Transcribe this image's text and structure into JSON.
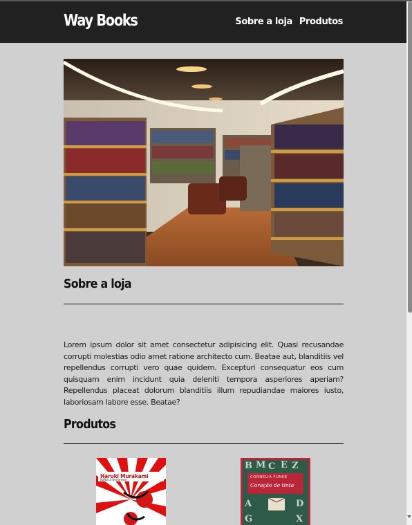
{
  "header": {
    "logo": "Way Books",
    "nav": [
      {
        "label": "Sobre a loja"
      },
      {
        "label": "Produtos"
      }
    ]
  },
  "about": {
    "title": "Sobre a loja",
    "text": "Lorem ipsum dolor sit amet consectetur adipisicing elit. Quasi recusandae corrupti molestias odio amet ratione architecto cum. Beatae aut, blanditiis vel repellendus corrupti vero quae quidem. Excepturi consequatur eos cum quisquam enim incidunt quia deleniti tempora asperiores aperiam? Repellendus placeat dolorum blanditiis illum repudiandae maiores iusto, laboriosam labore esse. Beatae?"
  },
  "products": {
    "title": "Produtos",
    "items": [
      {
        "author": "Haruki Murakami",
        "title": "Kafka à beira-mar"
      },
      {
        "author": "CORNELIA FUNKE",
        "title": "Coração de tinta"
      }
    ]
  },
  "colors": {
    "header_bg": "#222121",
    "page_bg": "#d0d0d0"
  }
}
